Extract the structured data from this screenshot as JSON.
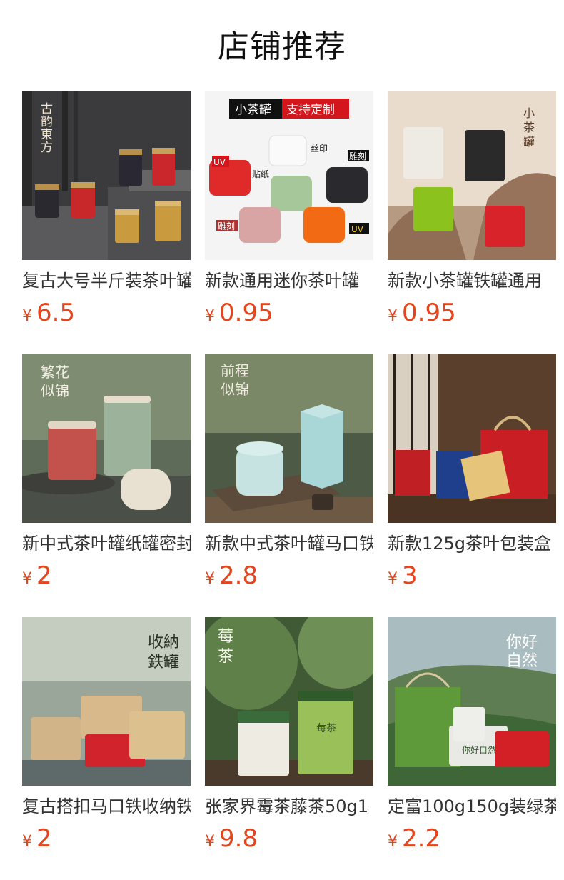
{
  "section_title": "店铺推荐",
  "currency_symbol": "¥",
  "colors": {
    "price": "#e5441c",
    "title": "#111111",
    "name": "#333333"
  },
  "products": [
    {
      "name": "复古大号半斤装茶叶罐",
      "price": "6.5",
      "image": "vintage-tea-cans-image",
      "image_text": [
        "古",
        "韵",
        "東",
        "方"
      ]
    },
    {
      "name": "新款通用迷你茶叶罐",
      "price": "0.95",
      "image": "mini-tea-cans-image",
      "image_text": [
        "小茶罐",
        "支持定制",
        "UV",
        "贴纸",
        "丝印",
        "雕刻",
        "雕刻",
        "UV"
      ]
    },
    {
      "name": "新款小茶罐铁罐通用",
      "price": "0.95",
      "image": "small-tin-cans-image",
      "image_text": [
        "小",
        "茶",
        "罐"
      ]
    },
    {
      "name": "新中式茶叶罐纸罐密封",
      "price": "2",
      "image": "paper-tea-cans-image",
      "image_text": [
        "繁花",
        "似锦"
      ]
    },
    {
      "name": "新款中式茶叶罐马口铁",
      "price": "2.8",
      "image": "hexagon-tea-cans-image",
      "image_text": [
        "前程",
        "似锦"
      ]
    },
    {
      "name": "新款125g茶叶包装盒",
      "price": "3",
      "image": "tea-gift-boxes-image",
      "image_text": []
    },
    {
      "name": "复古搭扣马口铁收纳铁罐",
      "price": "2",
      "image": "buckle-tins-image",
      "image_text": [
        "收納",
        "鉄罐"
      ]
    },
    {
      "name": "张家界霉茶藤茶50g1",
      "price": "9.8",
      "image": "vine-tea-tins-image",
      "image_text": [
        "莓",
        "茶",
        "莓茶"
      ]
    },
    {
      "name": "定富100g150g装绿茶",
      "price": "2.2",
      "image": "green-tea-packaging-image",
      "image_text": [
        "你好",
        "自然",
        "你好自然"
      ]
    }
  ]
}
